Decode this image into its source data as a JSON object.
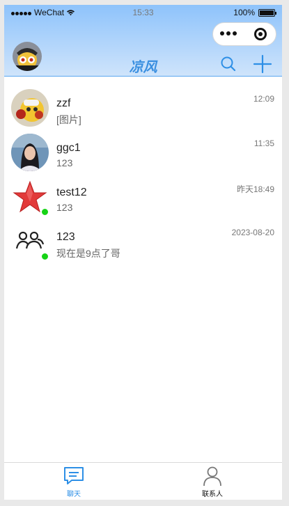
{
  "status_bar": {
    "carrier": "WeChat",
    "time": "15:33",
    "battery": "100%"
  },
  "header": {
    "title": "凉风"
  },
  "chats": [
    {
      "name": "zzf",
      "last_message": "[图片]",
      "time": "12:09",
      "online": false
    },
    {
      "name": "ggc1",
      "last_message": "123",
      "time": "11:35",
      "online": false
    },
    {
      "name": "test12",
      "last_message": "123",
      "time": "昨天18:49",
      "online": true
    },
    {
      "name": "123",
      "last_message": "现在是9点了哥",
      "time": "2023-08-20",
      "online": true
    }
  ],
  "tabbar": {
    "chat_label": "聊天",
    "contacts_label": "联系人"
  },
  "colors": {
    "accent": "#2d8fe6",
    "online": "#16d316"
  }
}
